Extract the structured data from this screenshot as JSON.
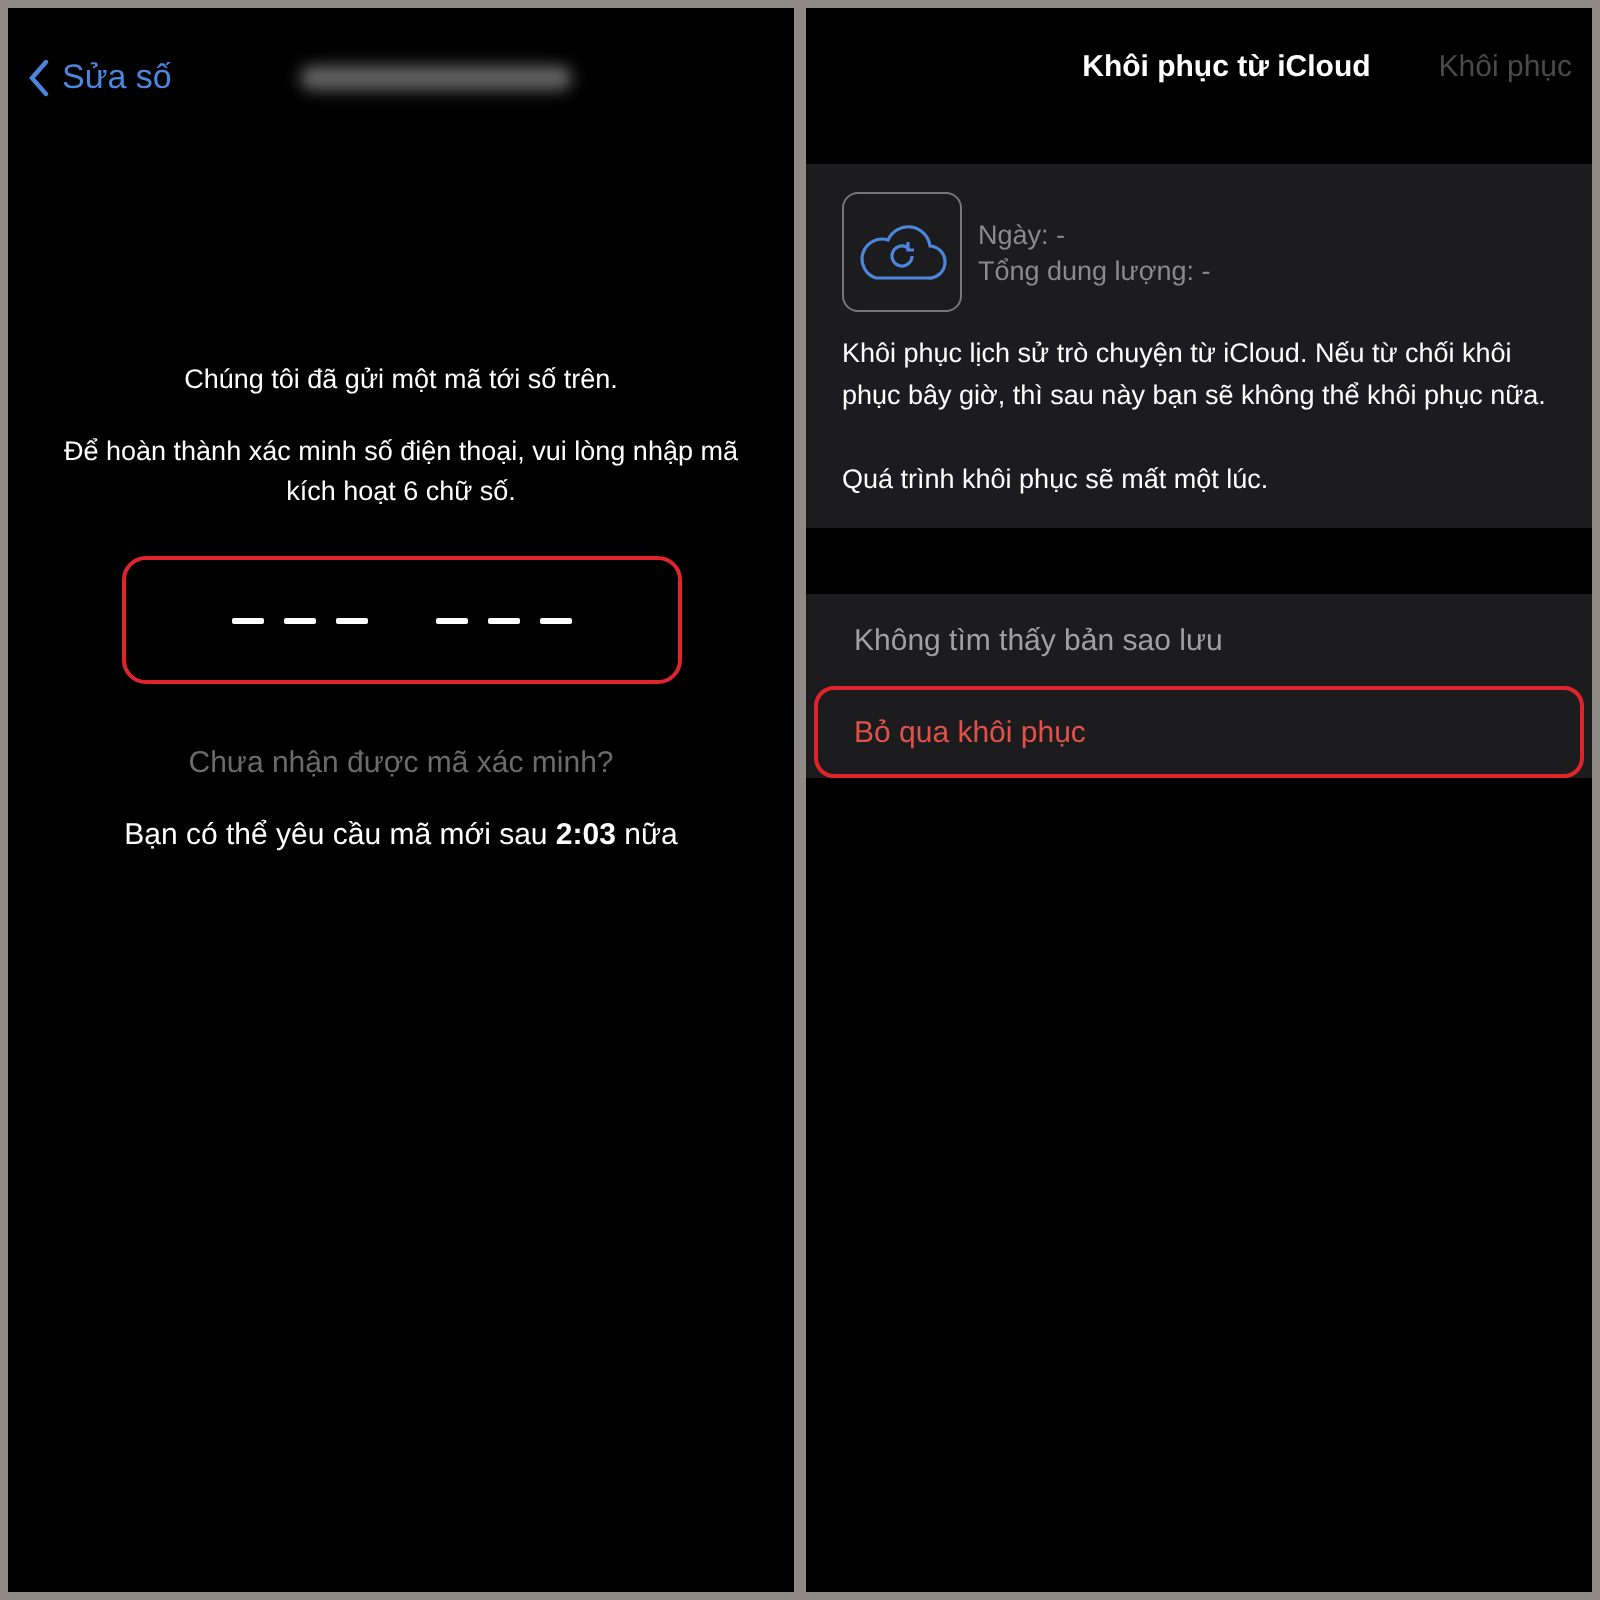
{
  "verify_screen": {
    "nav": {
      "back_label": "Sửa số"
    },
    "message": "Chúng tôi đã gửi một mã tới số trên.",
    "instruction": "Để hoàn thành xác minh số điện thoại, vui lòng nhập mã kích hoạt 6 chữ số.",
    "code_field": {
      "highlighted": true,
      "groups": [
        [
          {
            "filled": false
          },
          {
            "filled": false
          },
          {
            "filled": false
          }
        ],
        [
          {
            "filled": false
          },
          {
            "filled": false
          },
          {
            "filled": false
          }
        ]
      ]
    },
    "resend_link": {
      "label": "Chưa nhận được mã xác minh?",
      "disabled": true
    },
    "timer_text": "Bạn có thể yêu cầu mã mới sau **2:03** nữa"
  },
  "restore_screen": {
    "nav": {
      "title": "Khôi phục từ iCloud",
      "action": {
        "label": "Khôi phục",
        "disabled": true
      }
    },
    "backup_info": {
      "date": "Ngày: -",
      "total_size": "Tổng dung lượng: -"
    },
    "description": [
      "Khôi phục lịch sử trò chuyện từ iCloud. Nếu từ chối khôi phục bây giờ, thì sau này bạn sẽ không thể khôi phục nữa.",
      "Quá trình khôi phục sẽ mất một lúc."
    ],
    "options": [
      {
        "kind": "info",
        "label": "Không tìm thấy bản sao lưu",
        "highlighted": false
      },
      {
        "kind": "destructive",
        "label": "Bỏ qua khôi phục",
        "highlighted": true
      }
    ]
  }
}
